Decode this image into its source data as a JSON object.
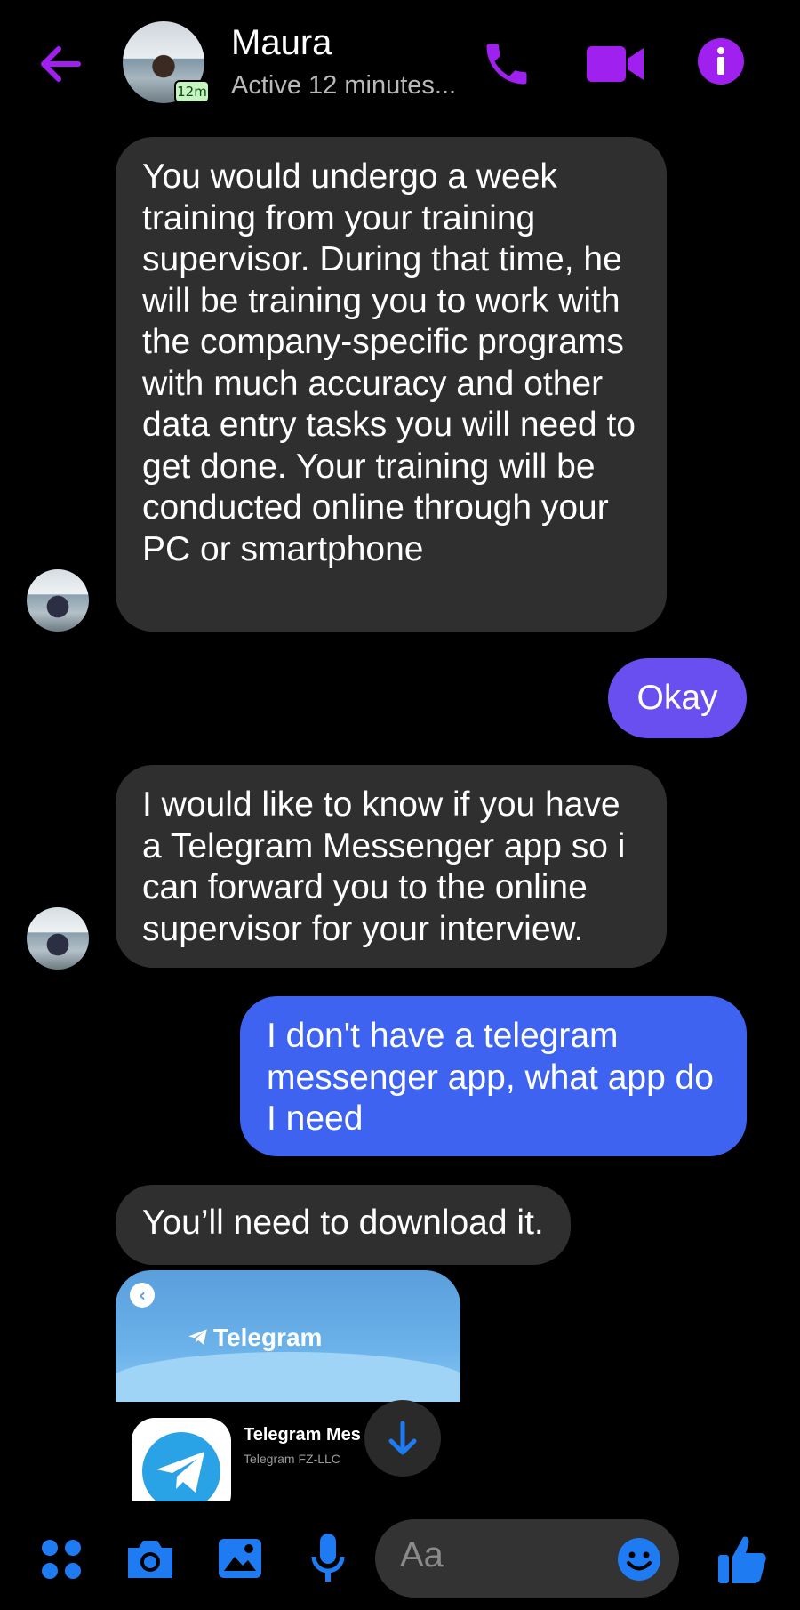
{
  "header": {
    "name": "Maura",
    "status": "Active 12 minutes...",
    "badge": "12m",
    "icons": [
      "back-arrow-icon",
      "phone-icon",
      "video-camera-icon",
      "info-icon"
    ],
    "accent_color": "#a020f0"
  },
  "messages": [
    {
      "direction": "incoming",
      "text": "You would undergo a week training from your training supervisor. During that time, he will be training you to work with the company-specific programs with much accuracy and other data entry tasks you will need to get done. Your training will be conducted online through your PC or smartphone"
    },
    {
      "direction": "outgoing",
      "text": "Okay"
    },
    {
      "direction": "incoming",
      "text": "I would like to know if you have a Telegram Messenger app so i can forward you to the online supervisor for your interview."
    },
    {
      "direction": "outgoing",
      "text": "I don't have a telegram messenger app, what app do I need"
    },
    {
      "direction": "incoming",
      "text": "You’ll need to download it."
    }
  ],
  "link_card": {
    "banner_title": "Telegram",
    "app_name": "Telegram Messenger",
    "developer": "Telegram FZ-LLC"
  },
  "composer": {
    "placeholder": "Aa",
    "icons": [
      "menu-dots-icon",
      "camera-icon",
      "gallery-icon",
      "microphone-icon",
      "emoji-icon",
      "thumbs-up-icon"
    ]
  },
  "colors": {
    "incoming_bubble": "#2f2f2f",
    "outgoing_bubble_1": "#6a4ff0",
    "outgoing_bubble_2": "#3d63f0",
    "icon_blue": "#1f7bf2"
  }
}
